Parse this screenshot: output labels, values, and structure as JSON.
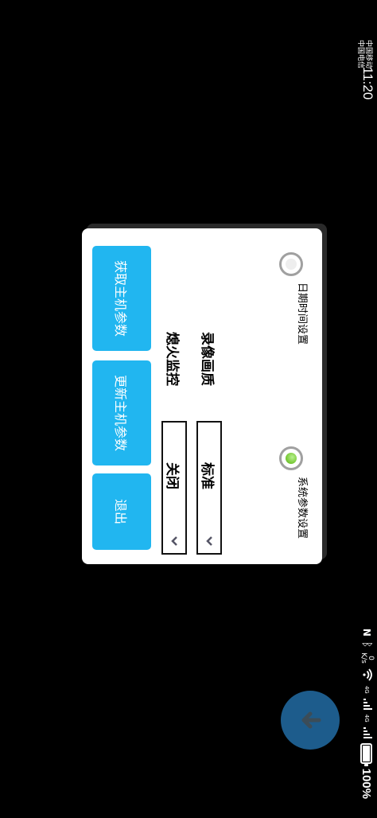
{
  "status_bar": {
    "carrier_1": "中国移动",
    "carrier_2": "中国电信",
    "time": "11:20",
    "net_speed_value": "0",
    "net_speed_unit": "K/s",
    "signal_1_tech": "4G",
    "signal_2_tech": "4G",
    "battery_percent": "100%"
  },
  "dialog": {
    "radios": [
      {
        "label": "日期时间设置",
        "selected": false
      },
      {
        "label": "系统参数设置",
        "selected": true
      }
    ],
    "settings": [
      {
        "label": "录像画质",
        "value": "标准"
      },
      {
        "label": "熄火监控",
        "value": "关闭"
      }
    ],
    "buttons": {
      "get_params": "获取主机参数",
      "update_params": "更新主机参数",
      "exit": "退出"
    }
  },
  "colors": {
    "button_bg": "#21b6f0",
    "fab_bg": "#1d5c8c",
    "radio_selected": "#7ccb3b"
  },
  "icons": {
    "fab": "arrow-down-icon",
    "select_chevron": "chevron-down-icon"
  }
}
